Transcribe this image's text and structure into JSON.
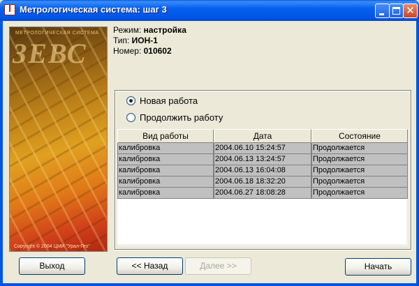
{
  "window": {
    "title": "Метрологическая система: шаг 3",
    "controls": {
      "minimize": "minimize-icon",
      "maximize": "maximize-icon",
      "close": "close-icon"
    }
  },
  "banner": {
    "subtitle": "МЕТРОЛОГИЧЕСКАЯ СИСТЕМА",
    "logo": "ЗЕВС",
    "copyright": "Copyright © 2004 ЦМИ \"Урал-Гео\""
  },
  "info": {
    "mode_label": "Режим: ",
    "mode_value": "настройка",
    "type_label": "Тип: ",
    "type_value": "ИОН-1",
    "number_label": "Номер: ",
    "number_value": "010602"
  },
  "options": {
    "new_work": "Новая работа",
    "continue_work": "Продолжить работу",
    "selected": "new_work"
  },
  "table": {
    "headers": [
      "Вид работы",
      "Дата",
      "Состояние"
    ],
    "rows": [
      [
        "калибровка",
        "2004.06.10 15:24:57",
        "Продолжается"
      ],
      [
        "калибровка",
        "2004.06.13 13:24:57",
        "Продолжается"
      ],
      [
        "калибровка",
        "2004.06.13 16:04:08",
        "Продолжается"
      ],
      [
        "калибровка",
        "2004.06.18 18:32:20",
        "Продолжается"
      ],
      [
        "калибровка",
        "2004.06.27 18:08:28",
        "Продолжается"
      ]
    ]
  },
  "buttons": {
    "exit": "Выход",
    "back": "<< Назад",
    "next": "Далее >>",
    "start": "Начать"
  },
  "colors": {
    "titlebar": "#0054E3",
    "face": "#ECE9D8",
    "row_fill": "#C0C0C0"
  }
}
